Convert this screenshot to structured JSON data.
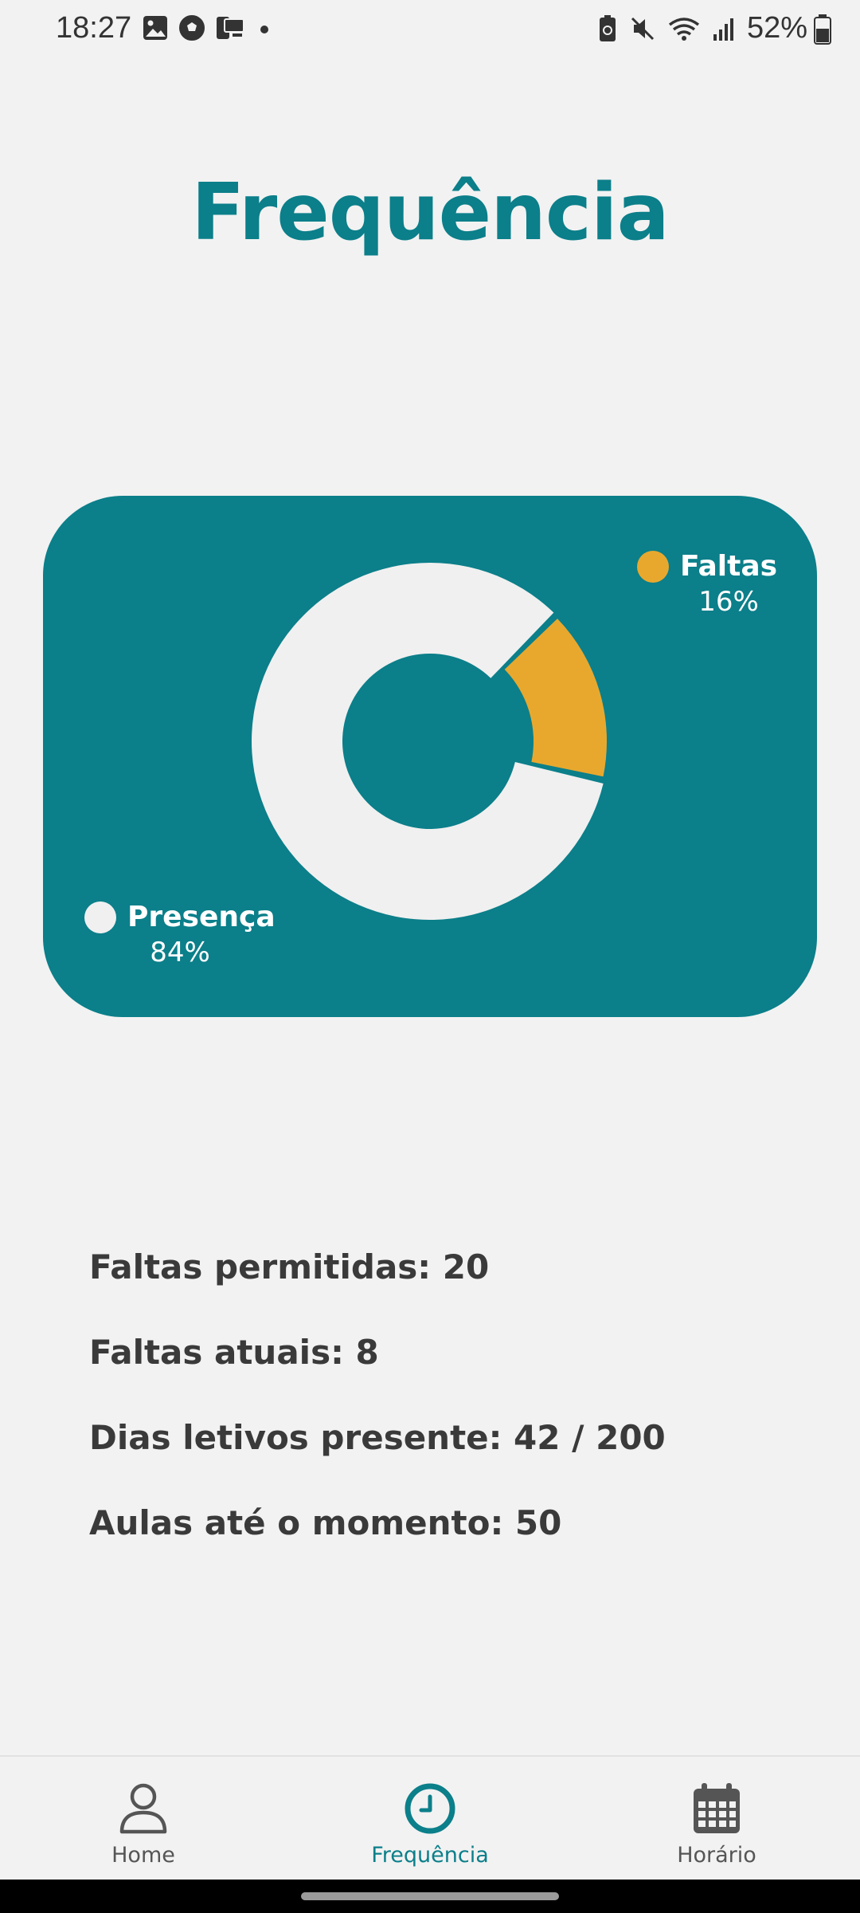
{
  "status_bar": {
    "time": "18:27",
    "battery_text": "52%",
    "left_icons": [
      "image-icon",
      "soccer-ball-icon",
      "device-transfer-icon",
      "notification-dot-icon"
    ],
    "right_icons": [
      "battery-saver-icon",
      "mute-icon",
      "wifi-icon",
      "signal-icon"
    ]
  },
  "page": {
    "title": "Frequência"
  },
  "chart_data": {
    "type": "pie",
    "variant": "donut",
    "slices": [
      {
        "label": "Faltas",
        "value": 16,
        "display": "16%",
        "color": "#e8a82e"
      },
      {
        "label": "Presença",
        "value": 84,
        "display": "84%",
        "color": "#f0f0f0"
      }
    ],
    "legend_placement": "faltas top-right, presença bottom-left"
  },
  "stats": [
    {
      "text": "Faltas permitidas: 20"
    },
    {
      "text": "Faltas atuais: 8"
    },
    {
      "text": "Dias letivos presente: 42 / 200"
    },
    {
      "text": "Aulas até o momento: 50"
    }
  ],
  "nav": {
    "items": [
      {
        "label": "Home",
        "icon": "person-icon",
        "active": false
      },
      {
        "label": "Frequência",
        "icon": "clock-icon",
        "active": true
      },
      {
        "label": "Horário",
        "icon": "calendar-icon",
        "active": false
      }
    ]
  },
  "colors": {
    "accent": "#0b7f8a",
    "faltas": "#e8a82e",
    "presenca": "#f0f0f0",
    "background": "#f2f2f2"
  }
}
